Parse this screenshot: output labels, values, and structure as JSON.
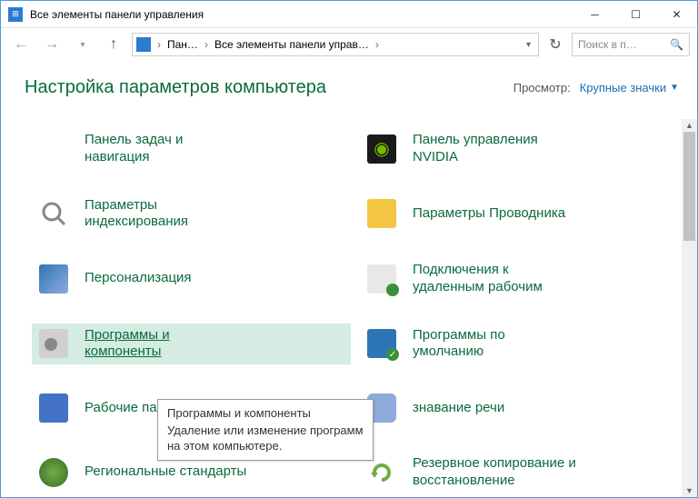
{
  "window": {
    "title": "Все элементы панели управления"
  },
  "breadcrumb": {
    "items": [
      "Пан…",
      "Все элементы панели управ…"
    ]
  },
  "search": {
    "placeholder": "Поиск в п…"
  },
  "header": {
    "title": "Настройка параметров компьютера",
    "view_label": "Просмотр:",
    "view_value": "Крупные значки"
  },
  "items": {
    "left": [
      {
        "name": "taskbar-nav",
        "label": "Панель задач и\nнавигация"
      },
      {
        "name": "indexing-options",
        "label": "Параметры\nиндексирования"
      },
      {
        "name": "personalization",
        "label": "Персонализация"
      },
      {
        "name": "programs-features",
        "label": "Программы и\nкомпоненты",
        "hover": true
      },
      {
        "name": "work-folders",
        "label": "Рабочие па"
      },
      {
        "name": "regional-standards",
        "label": "Региональные стандарты"
      }
    ],
    "right": [
      {
        "name": "nvidia-panel",
        "label": "Панель управления\nNVIDIA"
      },
      {
        "name": "explorer-options",
        "label": "Параметры Проводника"
      },
      {
        "name": "remote-desktop",
        "label": "Подключения к\nудаленным рабочим"
      },
      {
        "name": "default-programs",
        "label": "Программы по\nумолчанию"
      },
      {
        "name": "speech-recognition",
        "label": "знавание речи"
      },
      {
        "name": "backup-restore",
        "label": "Резервное копирование и\nвосстановление"
      }
    ]
  },
  "tooltip": {
    "title": "Программы и компоненты",
    "body": "Удаление или изменение программ\nна этом компьютере."
  },
  "icons": {
    "taskbar-nav": "#5b9bd5",
    "indexing-options": "#d0d0d0",
    "personalization": "#2e75b6",
    "programs-features": "#bfbfbf",
    "work-folders": "#4472c4",
    "regional-standards": "#70ad47",
    "nvidia-panel": "#3a8f3a",
    "explorer-options": "#f4b942",
    "remote-desktop": "#5b9bd5",
    "default-programs": "#2e75b6",
    "speech-recognition": "#8faadc",
    "backup-restore": "#70ad47"
  }
}
